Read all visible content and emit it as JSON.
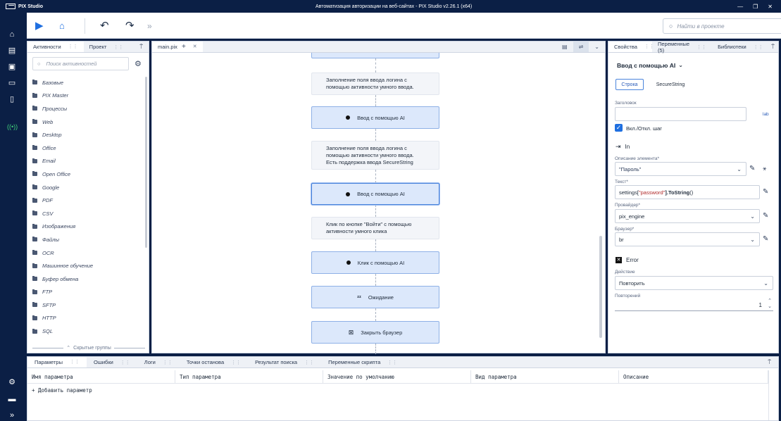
{
  "app": {
    "name": "PIX Studio",
    "window_title": "Автоматизация авторизации на веб-сайтах - PIX Studio v2.26.1 (x64)",
    "window_controls": [
      "minimize-icon",
      "restore-icon",
      "close-icon"
    ]
  },
  "sidebar": {
    "top_icons": [
      "home-icon",
      "calendar-icon",
      "save-icon",
      "folder-open-icon",
      "document-icon",
      "robot-signal-icon"
    ],
    "bottom_icons": [
      "settings-icon",
      "chat-icon",
      "expand-icon"
    ]
  },
  "toolbar": {
    "icons": [
      "run-icon",
      "run-settings-icon",
      "undo-icon",
      "redo-icon",
      "more-icon"
    ],
    "search_placeholder": "Найти в проекте"
  },
  "left_panel": {
    "tabs": [
      "Активности",
      "Проект"
    ],
    "search_placeholder": "Поиск активностей",
    "categories": [
      "Базовые",
      "PIX Master",
      "Процессы",
      "Web",
      "Desktop",
      "Office",
      "Email",
      "Open Office",
      "Google",
      "PDF",
      "CSV",
      "Изображения",
      "Файлы",
      "OCR",
      "Машинное обучение",
      "Буфер обмена",
      "FTP",
      "SFTP",
      "HTTP",
      "SQL"
    ],
    "hidden_groups": "Скрытые группы"
  },
  "canvas": {
    "tab": "main.pix",
    "nodes": [
      {
        "kind": "act",
        "label": "",
        "icon": "none"
      },
      {
        "kind": "desc",
        "lines": [
          "Заполнение поля ввода логина с",
          "помощью активности умного ввода."
        ]
      },
      {
        "kind": "act",
        "label": "Ввод с помощью AI",
        "icon": "dot"
      },
      {
        "kind": "desc",
        "lines": [
          "Заполнение поля ввода логина с",
          "помощью активности умного ввода.",
          "Есть поддержка ввода SecureString"
        ]
      },
      {
        "kind": "act",
        "label": "Ввод с помощью AI",
        "icon": "dot",
        "selected": true
      },
      {
        "kind": "desc",
        "lines": [
          "Клик по кнопке \"Войти\" с помощью",
          "активности умного клика"
        ]
      },
      {
        "kind": "act",
        "label": "Клик с помощью AI",
        "icon": "dot"
      },
      {
        "kind": "act",
        "label": "Ожидание",
        "icon": "zzz"
      },
      {
        "kind": "act",
        "label": "Закрыть браузер",
        "icon": "close-box"
      },
      {
        "kind": "act",
        "label": "",
        "icon": "none"
      }
    ]
  },
  "right_panel": {
    "tabs": [
      "Свойства",
      "Переменные (5)",
      "Библиотеки"
    ],
    "activity_title": "Ввод с помощью AI",
    "mode_tabs": [
      "Строка",
      "SecureString"
    ],
    "header_label": "Заголовок",
    "header_value": "",
    "step_toggle_label": "Вкл./Откл. шаг",
    "step_enabled": true,
    "in_section": "In",
    "element_desc_label": "Описание элемента*",
    "element_desc_value": "\"Пароль\"",
    "text_label": "Текст*",
    "text_prefix": "settings[",
    "text_string": "\"password\"",
    "text_method": "].ToString",
    "text_suffix": "()",
    "provider_label": "Провайдер*",
    "provider_value": "pix_engine",
    "browser_label": "Браузер*",
    "browser_value": "br",
    "error_section": "Error",
    "action_label": "Действие",
    "action_value": "Повторить",
    "retries_label": "Повторений",
    "retries_value": "1"
  },
  "bottom_panel": {
    "tabs": [
      "Параметры",
      "Ошибки",
      "Логи",
      "Точки останова",
      "Результат поиска",
      "Переменные скрипта"
    ],
    "columns": [
      "Имя параметра",
      "Тип параметра",
      "Значение по умолчанию",
      "Вид параметра",
      "Описание"
    ],
    "add_param": "+ Добавить параметр"
  }
}
